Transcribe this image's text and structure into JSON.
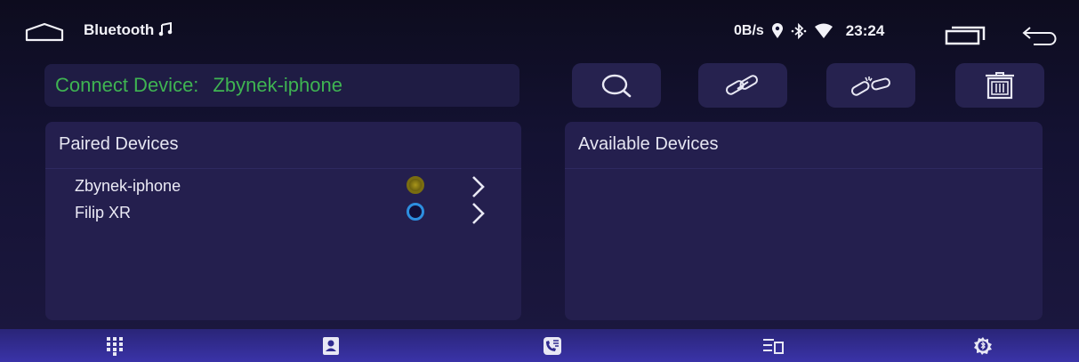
{
  "status_bar": {
    "title": "Bluetooth",
    "net_speed": "0B/s",
    "time": "23:24"
  },
  "connect_bar": {
    "label": "Connect Device:",
    "device": "Zbynek-iphone",
    "color": "#3fb452"
  },
  "toolbar": {
    "buttons": [
      {
        "icon": "search-icon"
      },
      {
        "icon": "link-icon"
      },
      {
        "icon": "unlink-icon"
      },
      {
        "icon": "trash-icon"
      }
    ]
  },
  "paired": {
    "title": "Paired Devices",
    "devices": [
      {
        "name": "Zbynek-iphone",
        "status_color": "#c8b31a"
      },
      {
        "name": "Filip XR",
        "status_color": "#2d8fe0"
      }
    ]
  },
  "available": {
    "title": "Available Devices",
    "devices": []
  },
  "bottom_nav": [
    {
      "icon": "dialpad-icon"
    },
    {
      "icon": "contacts-icon"
    },
    {
      "icon": "call-log-icon"
    },
    {
      "icon": "music-icon"
    },
    {
      "icon": "bluetooth-settings-icon"
    }
  ]
}
